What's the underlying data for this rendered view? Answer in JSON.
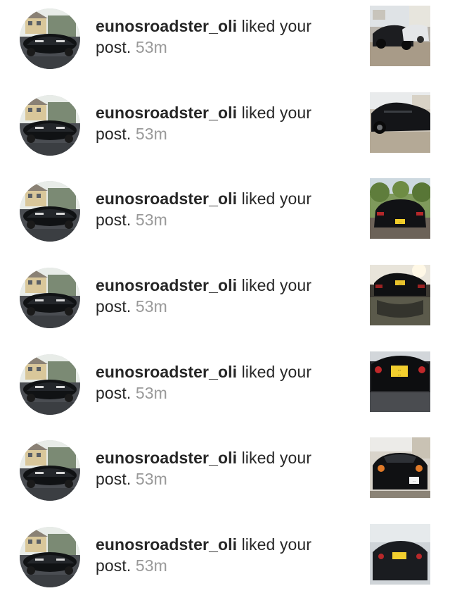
{
  "notifications": [
    {
      "username": "eunosroadster_oli",
      "action": "liked your",
      "action2": "post.",
      "time": "53m",
      "avatar_icon": "roadster-avatar",
      "thumb_icon": "car-photo-front-street"
    },
    {
      "username": "eunosroadster_oli",
      "action": "liked your",
      "action2": "post.",
      "time": "53m",
      "avatar_icon": "roadster-avatar",
      "thumb_icon": "car-photo-side-gravel"
    },
    {
      "username": "eunosroadster_oli",
      "action": "liked your",
      "action2": "post.",
      "time": "53m",
      "avatar_icon": "roadster-avatar",
      "thumb_icon": "car-photo-rear-trees"
    },
    {
      "username": "eunosroadster_oli",
      "action": "liked your",
      "action2": "post.",
      "time": "53m",
      "avatar_icon": "roadster-avatar",
      "thumb_icon": "car-photo-rear-reflection"
    },
    {
      "username": "eunosroadster_oli",
      "action": "liked your",
      "action2": "post.",
      "time": "53m",
      "avatar_icon": "roadster-avatar",
      "thumb_icon": "car-photo-rear-plate"
    },
    {
      "username": "eunosroadster_oli",
      "action": "liked your",
      "action2": "post.",
      "time": "53m",
      "avatar_icon": "roadster-avatar",
      "thumb_icon": "car-photo-front-headlights"
    },
    {
      "username": "eunosroadster_oli",
      "action": "liked your",
      "action2": "post.",
      "time": "53m",
      "avatar_icon": "roadster-avatar",
      "thumb_icon": "car-photo-rear-plate-2"
    }
  ],
  "plates": {
    "p3": "...",
    "p4": "...",
    "p5a": "...",
    "p5b": "...",
    "p6": "..."
  },
  "colors": {
    "text": "#262626",
    "time": "#999999",
    "background": "#ffffff"
  }
}
